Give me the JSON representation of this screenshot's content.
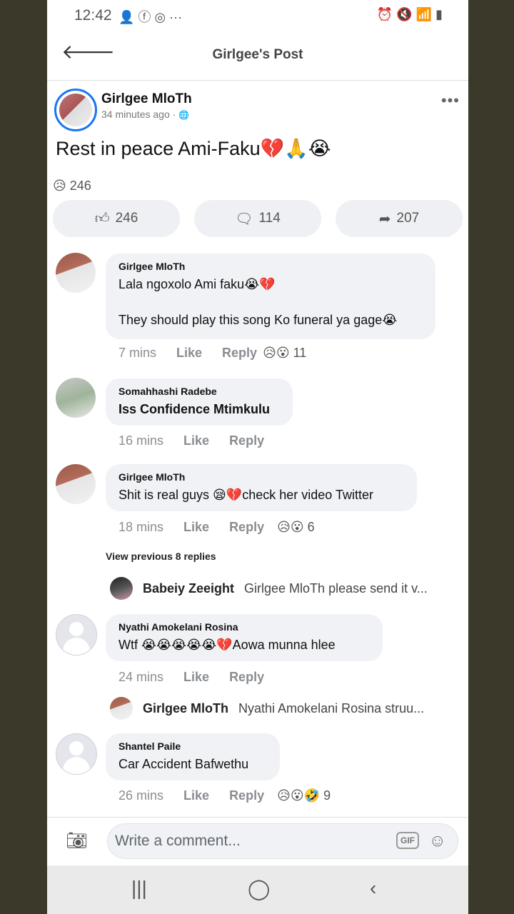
{
  "status_bar": {
    "time": "12:42",
    "left_icons": "👤 ⓕ ◎ ···",
    "right_icons": "⏰ 🔇 📶 ▮"
  },
  "header": {
    "title": "Girlgee's Post"
  },
  "post": {
    "author": "Girlgee MloTh",
    "time": "34 minutes ago ·",
    "globe": "🌐",
    "text": "Rest in peace Ami-Faku💔🙏😭",
    "reaction_summary": "😥 246",
    "more": "•••"
  },
  "actions": {
    "like": "246",
    "comment": "114",
    "share": "207"
  },
  "comments": [
    {
      "name": "Girlgee MloTh",
      "line1": "Lala ngoxolo Ami faku😭💔",
      "line2": "They should play this song Ko funeral ya gage😭",
      "time": "7 mins",
      "like": "Like",
      "reply": "Reply",
      "reactions": "😥😮",
      "count": "11"
    },
    {
      "name": "Somahhashi Radebe",
      "text": "Iss Confidence Mtimkulu",
      "time": "16 mins",
      "like": "Like",
      "reply": "Reply"
    },
    {
      "name": "Girlgee MloTh",
      "text": "Shit is real guys 😪💔check her video Twitter",
      "time": "18 mins",
      "like": "Like",
      "reply": "Reply",
      "reactions": "😥😮",
      "count": "6"
    },
    {
      "name": "Nyathi Amokelani Rosina",
      "text": "Wtf 😭😭😭😭😭💔Aowa munna hlee",
      "time": "24 mins",
      "like": "Like",
      "reply": "Reply"
    },
    {
      "name": "Shantel Paile",
      "text": "Car Accident Bafwethu",
      "time": "26 mins",
      "like": "Like",
      "reply": "Reply",
      "reactions": "😥😮🤣",
      "count": "9"
    }
  ],
  "view_previous": "View previous 8 replies",
  "replies": [
    {
      "name": "Babeiy Zeeight",
      "text": "Girlgee MloTh please send it v..."
    },
    {
      "name": "Girlgee MloTh",
      "text": "Nyathi Amokelani Rosina struu..."
    }
  ],
  "composer": {
    "placeholder": "Write a comment...",
    "gif": "GIF"
  },
  "nav": {
    "recents": "|||",
    "home": "◯",
    "back": "‹"
  }
}
